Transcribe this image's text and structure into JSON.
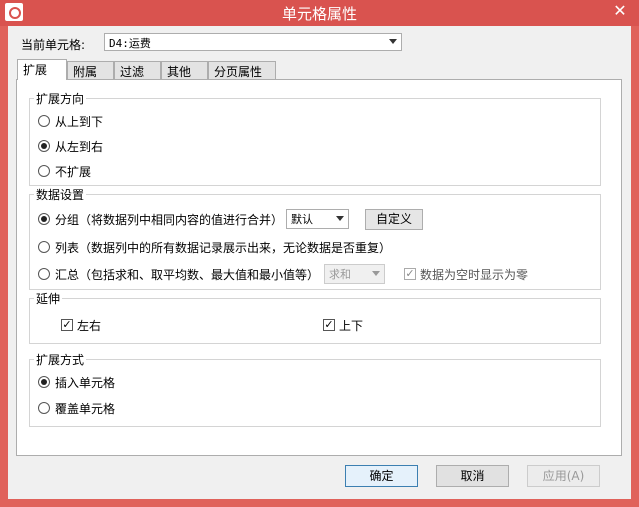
{
  "window": {
    "title": "单元格属性",
    "close": "✕"
  },
  "current_cell": {
    "label": "当前单元格:",
    "value": "D4:运费"
  },
  "tabs": [
    "扩展",
    "附属",
    "过滤",
    "其他",
    "分页属性"
  ],
  "direction": {
    "title": "扩展方向",
    "options": [
      "从上到下",
      "从左到右",
      "不扩展"
    ],
    "selected": 1
  },
  "data_settings": {
    "title": "数据设置",
    "group_label": "分组（将数据列中相同内容的值进行合并）",
    "group_select": "默认",
    "custom_button": "自定义",
    "list_label": "列表（数据列中的所有数据记录展示出来，无论数据是否重复）",
    "summary_label": "汇总（包括求和、取平均数、最大值和最小值等）",
    "summary_select": "求和",
    "empty_zero_label": "数据为空时显示为零",
    "empty_zero_checked": true,
    "selected": 0
  },
  "extend": {
    "title": "延伸",
    "left_right": "左右",
    "up_down": "上下",
    "left_right_checked": true,
    "up_down_checked": true
  },
  "expand_mode": {
    "title": "扩展方式",
    "options": [
      "插入单元格",
      "覆盖单元格"
    ],
    "selected": 0
  },
  "buttons": {
    "ok": "确定",
    "cancel": "取消",
    "apply": "应用(A)"
  }
}
